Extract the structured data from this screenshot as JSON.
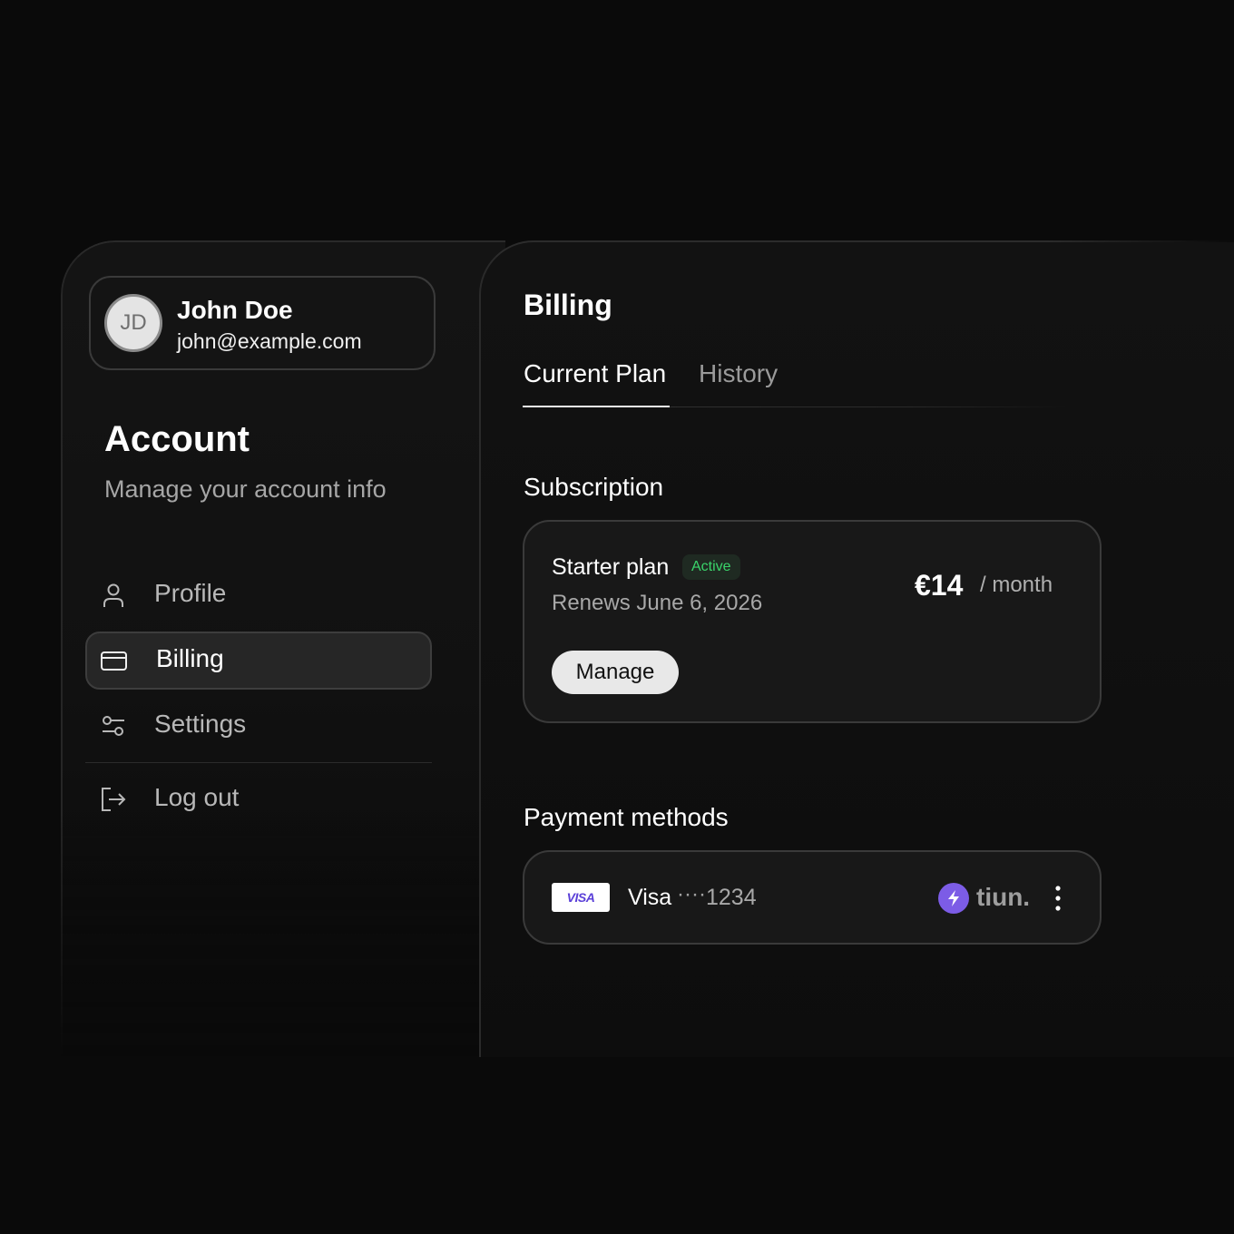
{
  "user": {
    "initials": "JD",
    "name": "John Doe",
    "email": "john@example.com"
  },
  "sidebar": {
    "title": "Account",
    "subtitle": "Manage your account info",
    "items": [
      {
        "label": "Profile",
        "icon": "user-icon",
        "active": false
      },
      {
        "label": "Billing",
        "icon": "credit-card-icon",
        "active": true
      },
      {
        "label": "Settings",
        "icon": "sliders-icon",
        "active": false
      },
      {
        "label": "Log out",
        "icon": "logout-icon",
        "active": false
      }
    ]
  },
  "main": {
    "title": "Billing",
    "tabs": [
      {
        "label": "Current Plan",
        "active": true
      },
      {
        "label": "History",
        "active": false
      }
    ],
    "subscription": {
      "section_title": "Subscription",
      "plan_name": "Starter plan",
      "status": "Active",
      "renews": "Renews June 6, 2026",
      "price": "€14",
      "period": "/ month",
      "manage_label": "Manage"
    },
    "payment": {
      "section_title": "Payment methods",
      "card_logo": "VISA",
      "card_brand": "Visa",
      "card_mask": "····",
      "card_last4": "1234",
      "provider": "tiun."
    }
  },
  "colors": {
    "background": "#0a0a0a",
    "active_badge": "#3ad46a",
    "provider_accent": "#7c5ce6",
    "visa_text": "#5a3fd8"
  }
}
